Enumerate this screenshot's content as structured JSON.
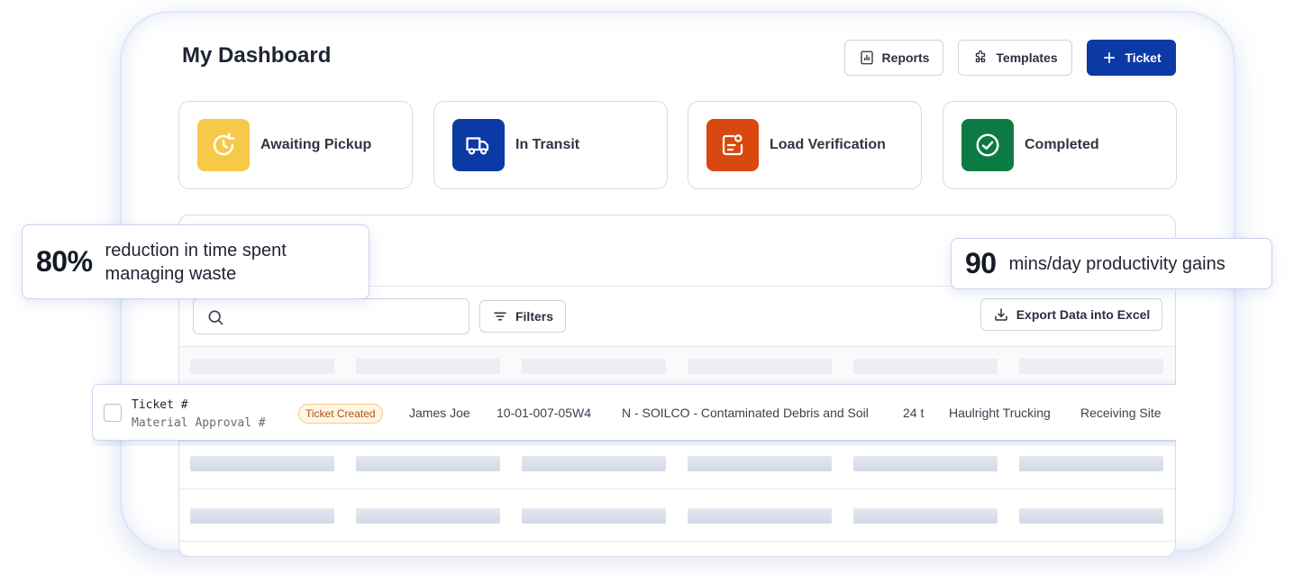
{
  "header": {
    "title": "My Dashboard",
    "reports_label": "Reports",
    "templates_label": "Templates",
    "ticket_label": "Ticket"
  },
  "status_cards": [
    {
      "label": "Awaiting Pickup",
      "icon": "clock-rotate-icon",
      "color": "#f7c948"
    },
    {
      "label": "In Transit",
      "icon": "truck-icon",
      "color": "#0b3aa5"
    },
    {
      "label": "Load Verification",
      "icon": "document-check-icon",
      "color": "#d9480f"
    },
    {
      "label": "Completed",
      "icon": "check-circle-icon",
      "color": "#0c7a43"
    }
  ],
  "toolbar": {
    "search_placeholder": "",
    "filters_label": "Filters",
    "export_label": "Export Data into Excel"
  },
  "highlighted_row": {
    "ticket_label": "Ticket #",
    "material_label": "Material Approval #",
    "status_badge": "Ticket Created",
    "driver": "James Joe",
    "location_code": "10-01-007-05W4",
    "material": "N - SOILCO - Contaminated Debris and Soil",
    "weight": "24 t",
    "carrier": "Haulright Trucking",
    "destination": "Receiving Site"
  },
  "stats": {
    "reduction_value": "80%",
    "reduction_text": "reduction in time spent managing waste",
    "productivity_value": "90",
    "productivity_text": "mins/day productivity gains"
  },
  "colors": {
    "primary": "#0b3aa5",
    "badge_text": "#b4520e",
    "badge_bg": "#fff6e6"
  }
}
